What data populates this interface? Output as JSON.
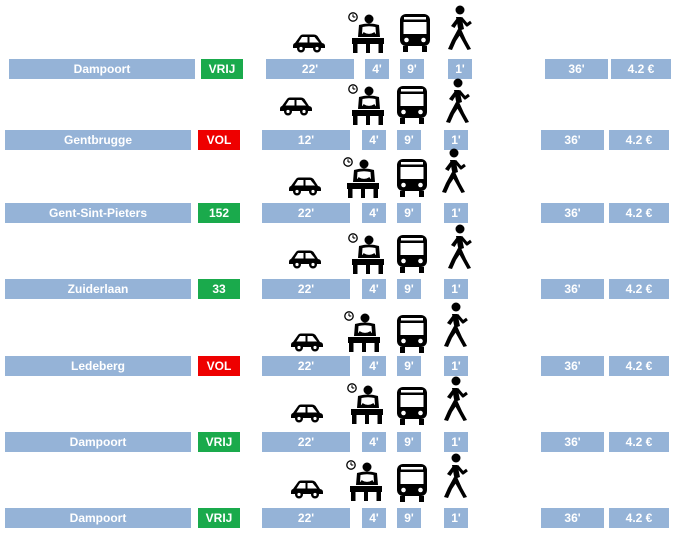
{
  "colors": {
    "cell_bg": "#95b3d7",
    "text": "#ffffff",
    "status_green": "#1aaa4c",
    "status_red": "#ee0000",
    "icon": "#000000"
  },
  "icons": [
    "car-icon",
    "waiting-person-clock-icon",
    "bus-icon",
    "walking-person-icon"
  ],
  "rows": [
    {
      "name": "Dampoort",
      "status": "VRIJ",
      "status_color": "green",
      "car": "22'",
      "wait": "4'",
      "bus": "9'",
      "walk": "1'",
      "total": "36'",
      "price": "4.2 €"
    },
    {
      "name": "Gentbrugge",
      "status": "VOL",
      "status_color": "red",
      "car": "12'",
      "wait": "4'",
      "bus": "9'",
      "walk": "1'",
      "total": "36'",
      "price": "4.2 €"
    },
    {
      "name": "Gent-Sint-Pieters",
      "status": "152",
      "status_color": "green",
      "car": "22'",
      "wait": "4'",
      "bus": "9'",
      "walk": "1'",
      "total": "36'",
      "price": "4.2 €"
    },
    {
      "name": "Zuiderlaan",
      "status": "33",
      "status_color": "green",
      "car": "22'",
      "wait": "4'",
      "bus": "9'",
      "walk": "1'",
      "total": "36'",
      "price": "4.2 €"
    },
    {
      "name": "Ledeberg",
      "status": "VOL",
      "status_color": "red",
      "car": "22'",
      "wait": "4'",
      "bus": "9'",
      "walk": "1'",
      "total": "36'",
      "price": "4.2 €"
    },
    {
      "name": "Dampoort",
      "status": "VRIJ",
      "status_color": "green",
      "car": "22'",
      "wait": "4'",
      "bus": "9'",
      "walk": "1'",
      "total": "36'",
      "price": "4.2 €"
    },
    {
      "name": "Dampoort",
      "status": "VRIJ",
      "status_color": "green",
      "car": "22'",
      "wait": "4'",
      "bus": "9'",
      "walk": "1'",
      "total": "36'",
      "price": "4.2 €"
    }
  ]
}
